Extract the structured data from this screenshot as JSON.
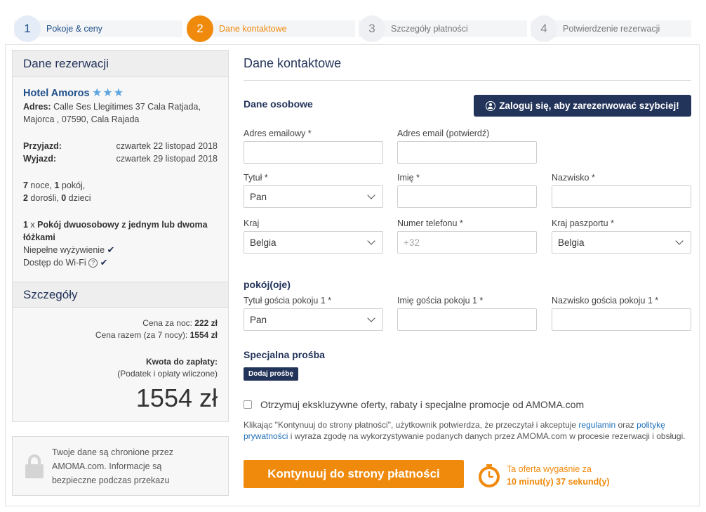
{
  "steps": [
    {
      "num": "1",
      "label": "Pokoje & ceny",
      "state": "done"
    },
    {
      "num": "2",
      "label": "Dane kontaktowe",
      "state": "active"
    },
    {
      "num": "3",
      "label": "Szczegóły płatności",
      "state": "todo"
    },
    {
      "num": "4",
      "label": "Potwierdzenie rezerwacji",
      "state": "todo"
    }
  ],
  "reservation": {
    "heading": "Dane rezerwacji",
    "hotel_name": "Hotel Amoros",
    "stars": "★★★",
    "address_label": "Adres:",
    "address": "Calle Ses Llegitimes 37 Cala Ratjada, Majorca , 07590, Cala Rajada",
    "checkin_label": "Przyjazd:",
    "checkin": "czwartek 22 listopad 2018",
    "checkout_label": "Wyjazd:",
    "checkout": "czwartek 29 listopad 2018",
    "nights_num": "7",
    "nights_text": " noce, ",
    "rooms_num": "1",
    "rooms_text": " pokój,",
    "adults_num": "2",
    "adults_text": " dorośli, ",
    "children_num": "0",
    "children_text": " dzieci",
    "room_count": "1",
    "room_x": " x ",
    "room_type": "Pokój dwuosobowy z jednym lub dwoma łóżkami",
    "board": "Niepełne wyżywienie",
    "wifi": "Dostęp do Wi-Fi"
  },
  "details": {
    "heading": "Szczegóły",
    "per_night_label": "Cena za noc:",
    "per_night": "222 zł",
    "total_label": "Cena razem (za 7 nocy):",
    "total": "1554 zł",
    "due_label": "Kwota do zapłaty:",
    "due_note": "(Podatek i opłaty wliczone)",
    "due_amount": "1554 zł"
  },
  "secure_note": "Twoje dane są chronione przez AMOMA.com. Informacje są bezpieczne podczas przekazu",
  "form": {
    "title": "Dane kontaktowe",
    "personal_heading": "Dane osobowe",
    "login_button": "Zaloguj się, aby zarezerwować szybciej!",
    "email_label": "Adres emailowy *",
    "email_value": "",
    "email_confirm_label": "Adres email (potwierdź)",
    "email_confirm_value": "",
    "title_label": "Tytuł *",
    "title_value": "Pan",
    "firstname_label": "Imię *",
    "firstname_value": "",
    "lastname_label": "Nazwisko *",
    "lastname_value": "",
    "country_label": "Kraj",
    "country_value": "Belgia",
    "phone_label": "Numer telefonu *",
    "phone_placeholder": "+32",
    "passport_label": "Kraj paszportu *",
    "passport_value": "Belgia",
    "rooms_heading": "pokój(oje)",
    "guest_title_label": "Tytuł gościa pokoju 1 *",
    "guest_title_value": "Pan",
    "guest_firstname_label": "Imię gościa pokoju 1 *",
    "guest_firstname_value": "",
    "guest_lastname_label": "Nazwisko gościa pokoju 1 *",
    "guest_lastname_value": "",
    "special_heading": "Specjalna prośba",
    "add_request_button": "Dodaj prośbę",
    "optin_text": "Otrzymuj ekskluzywne oferty, rabaty i specjalne promocje od AMOMA.com",
    "legal_1": "Klikając \"Kontynuuj do strony płatności\", użytkownik potwierdza, że przeczytał i akceptuje ",
    "legal_link_terms": "regulamin",
    "legal_2": " oraz ",
    "legal_link_privacy": "politykę prywatności",
    "legal_3": " i wyraża zgodę na wykorzystywanie podanych danych przez AMOMA.com w procesie rezerwacji i obsługi.",
    "continue_button": "Kontynuuj do strony płatności",
    "timer_line1": "Ta oferta wygaśnie za",
    "timer_line2": "10 minut(y) 37 sekund(y)"
  },
  "colors": {
    "navy": "#23345a",
    "orange": "#f08a0c",
    "link": "#1f6fb8"
  }
}
